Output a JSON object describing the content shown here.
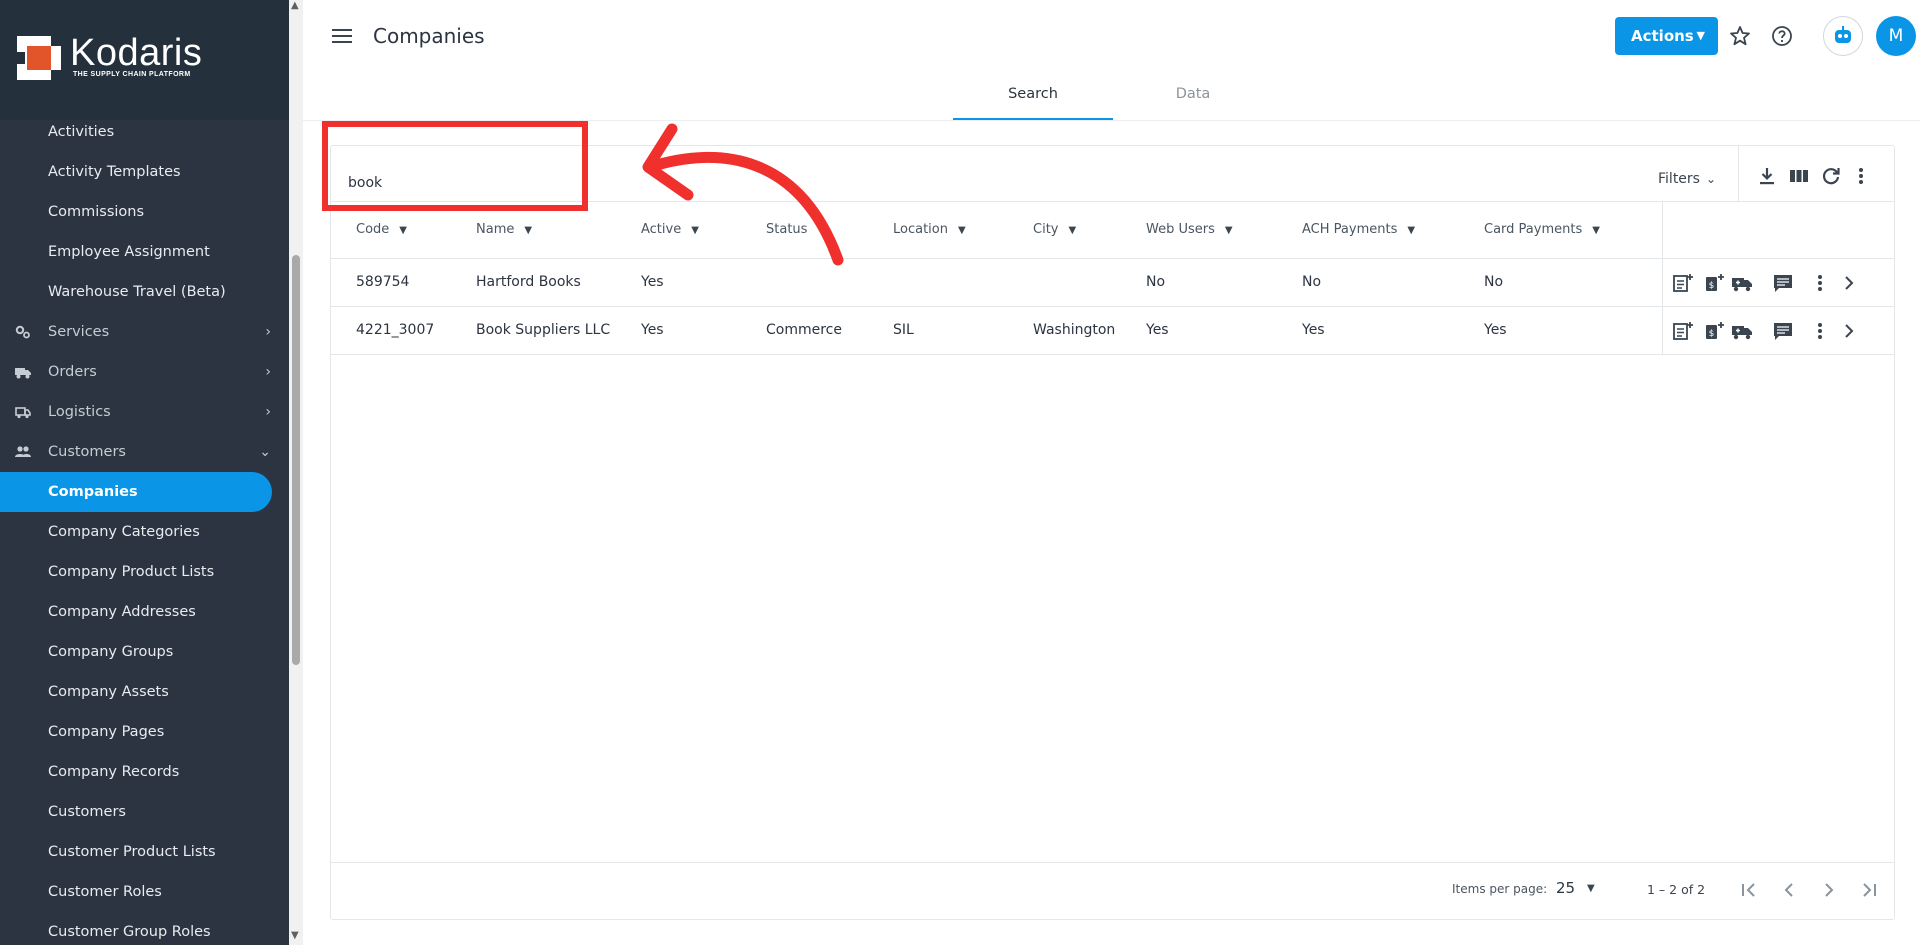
{
  "brand": {
    "name": "Kodaris",
    "tagline": "THE SUPPLY CHAIN PLATFORM",
    "accent": "#0b95e6",
    "logo_orange": "#e2552a"
  },
  "sidebar": {
    "items": [
      {
        "label": "Activities",
        "type": "child"
      },
      {
        "label": "Activity Templates",
        "type": "child"
      },
      {
        "label": "Commissions",
        "type": "child"
      },
      {
        "label": "Employee Assignment",
        "type": "child"
      },
      {
        "label": "Warehouse Travel (Beta)",
        "type": "child"
      },
      {
        "label": "Services",
        "type": "parent",
        "icon": "gears-icon",
        "chevron": "right"
      },
      {
        "label": "Orders",
        "type": "parent",
        "icon": "truck-icon",
        "chevron": "right"
      },
      {
        "label": "Logistics",
        "type": "parent",
        "icon": "shipping-icon",
        "chevron": "right"
      },
      {
        "label": "Customers",
        "type": "parent",
        "icon": "people-icon",
        "chevron": "down"
      },
      {
        "label": "Companies",
        "type": "child",
        "active": true
      },
      {
        "label": "Company Categories",
        "type": "child"
      },
      {
        "label": "Company Product Lists",
        "type": "child"
      },
      {
        "label": "Company Addresses",
        "type": "child"
      },
      {
        "label": "Company Groups",
        "type": "child"
      },
      {
        "label": "Company Assets",
        "type": "child"
      },
      {
        "label": "Company Pages",
        "type": "child"
      },
      {
        "label": "Company Records",
        "type": "child"
      },
      {
        "label": "Customers",
        "type": "child"
      },
      {
        "label": "Customer Product Lists",
        "type": "child"
      },
      {
        "label": "Customer Roles",
        "type": "child"
      },
      {
        "label": "Customer Group Roles",
        "type": "child"
      }
    ]
  },
  "header": {
    "title": "Companies",
    "actions_label": "Actions",
    "avatar_initial": "M"
  },
  "tabs": [
    {
      "label": "Search",
      "active": true
    },
    {
      "label": "Data",
      "active": false
    }
  ],
  "search": {
    "value": "book",
    "filters_label": "Filters"
  },
  "table": {
    "columns": [
      "Code",
      "Name",
      "Active",
      "Status",
      "Location",
      "City",
      "Web Users",
      "ACH Payments",
      "Card Payments"
    ],
    "rows": [
      {
        "code": "589754",
        "name": "Hartford Books",
        "active": "Yes",
        "status": "",
        "location": "",
        "city": "",
        "web_users": "No",
        "ach": "No",
        "card": "No"
      },
      {
        "code": "4221_3007",
        "name": "Book Suppliers LLC",
        "active": "Yes",
        "status": "Commerce",
        "location": "SIL",
        "city": "Washington",
        "web_users": "Yes",
        "ach": "Yes",
        "card": "Yes"
      }
    ]
  },
  "pagination": {
    "items_per_page_label": "Items per page:",
    "items_per_page": "25",
    "range": "1 – 2 of 2"
  },
  "annotation": {
    "color": "#f0302d"
  }
}
